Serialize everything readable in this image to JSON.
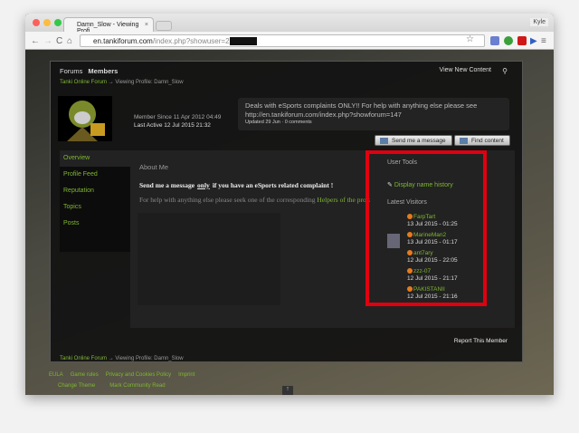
{
  "browser": {
    "tab_title": "Damn_Slow - Viewing Profi",
    "user": "Kyle",
    "url_host": "en.tankiforum.com",
    "url_path": "/index.php?showuser=2"
  },
  "nav": {
    "forums": "Forums",
    "members": "Members",
    "view_new": "View New Content"
  },
  "breadcrumb": {
    "root": "Tanki Online Forum",
    "arrow": "→",
    "current": "Viewing Profile: Damn_Slow"
  },
  "profile": {
    "member_since": "Member Since 11 Apr 2012 04:49",
    "last_active": "Last Active 12 Jul 2015 21:32",
    "status_text": "Deals with eSports complaints ONLY!! For help with anything else please see http://en.tankiforum.com/index.php?showforum=147",
    "status_meta": "Updated 29 Jun · 0 comments"
  },
  "buttons": {
    "send": "Send me a message",
    "find": "Find content",
    "report": "Report This Member"
  },
  "tabs": [
    "Overview",
    "Profile Feed",
    "Reputation",
    "Topics",
    "Posts"
  ],
  "about": {
    "title": "About Me",
    "msg_a": "Send me a message",
    "msg_b": "only",
    "msg_c": "if you have an eSports related complaint !",
    "help": "For help with anything else please seek one of the corresponding",
    "help_link": "Helpers of the project"
  },
  "tools": {
    "title": "User Tools",
    "name_history": "Display name history",
    "visitors_title": "Latest Visitors",
    "visitors": [
      {
        "name": "FarpTart",
        "date": "13 Jul 2015 - 01:25"
      },
      {
        "name": "MarineMan2",
        "date": "13 Jul 2015 - 01:17"
      },
      {
        "name": "ant7ary",
        "date": "12 Jul 2015 - 22:05"
      },
      {
        "name": "zzz-07",
        "date": "12 Jul 2015 - 21:17"
      },
      {
        "name": "PAKISTANII",
        "date": "12 Jul 2015 - 21:16"
      }
    ]
  },
  "footer": {
    "links1": [
      "EULA",
      "Game rules",
      "Privacy and Cookies Policy",
      "Imprint"
    ],
    "links2": [
      "Change Theme",
      "Mark Community Read"
    ]
  },
  "colors": {
    "accent": "#7fb732",
    "highlight": "#e00010"
  }
}
